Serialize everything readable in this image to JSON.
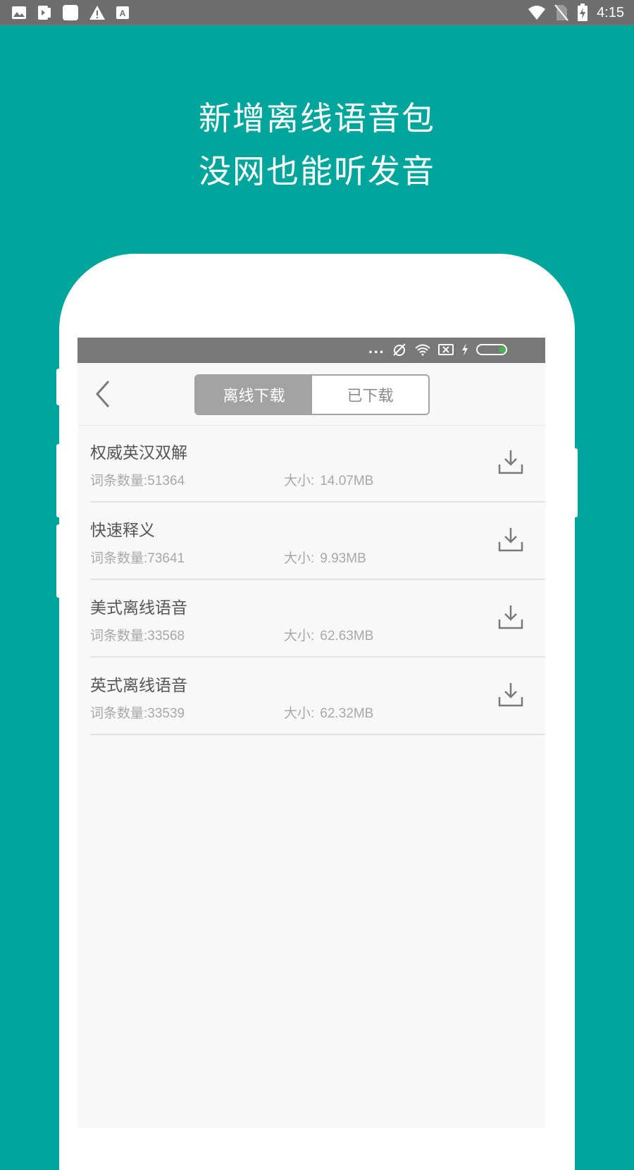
{
  "system_status": {
    "time": "4:15",
    "left_icons": [
      "image-icon",
      "media-icon",
      "square-icon",
      "warning-icon",
      "font-icon"
    ],
    "right_icons": [
      "wifi-icon",
      "no-sim-icon",
      "battery-charging-icon"
    ]
  },
  "headline": {
    "line1": "新增离线语音包",
    "line2": "没网也能听发音"
  },
  "inner_status": {
    "dots": "...",
    "icons": [
      "alarm-off-icon",
      "wifi-icon",
      "sim-x-icon",
      "charging-icon",
      "battery-icon"
    ]
  },
  "tabs": {
    "active": "离线下载",
    "inactive": "已下载"
  },
  "packages": [
    {
      "title": "权威英汉双解",
      "count": "词条数量:51364",
      "size_label": "大小:",
      "size": "14.07MB"
    },
    {
      "title": "快速释义",
      "count": "词条数量:73641",
      "size_label": "大小:",
      "size": "9.93MB"
    },
    {
      "title": "美式离线语音",
      "count": "词条数量:33568",
      "size_label": "大小:",
      "size": "62.63MB"
    },
    {
      "title": "英式离线语音",
      "count": "词条数量:33539",
      "size_label": "大小:",
      "size": "62.32MB"
    }
  ],
  "colors": {
    "background": "#00a69c",
    "segment_active": "#a3a3a3",
    "status_bar": "#6e6e6e"
  }
}
